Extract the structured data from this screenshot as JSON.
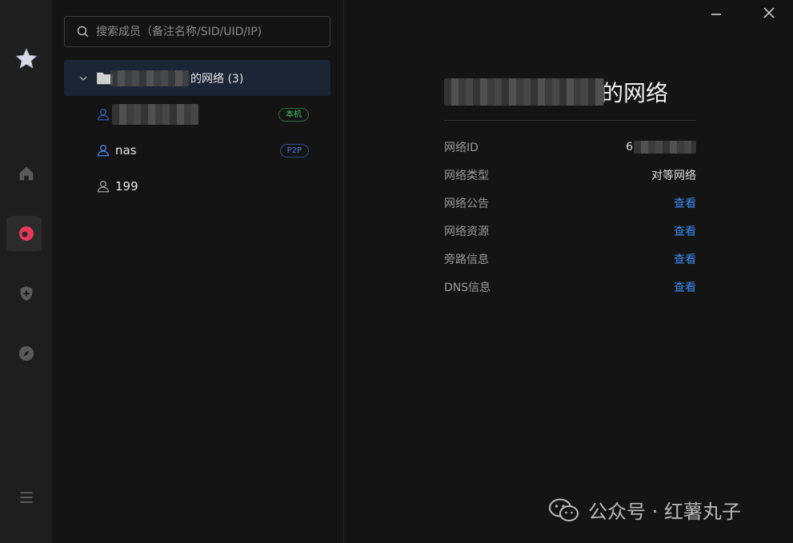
{
  "search": {
    "placeholder": "搜索成员（备注名称/SID/UID/IP)"
  },
  "group": {
    "label_suffix": "的网络 (3)"
  },
  "members": [
    {
      "name": "",
      "badge": "本机",
      "badge_kind": "local",
      "icon_color": "#2f5aa8"
    },
    {
      "name": "nas",
      "badge": "P2P",
      "badge_kind": "p2p",
      "icon_color": "#4b80e0"
    },
    {
      "name": "199",
      "badge": "",
      "badge_kind": "",
      "icon_color": "#9a9a9a"
    }
  ],
  "detail": {
    "title_suffix": "的网络",
    "rows": [
      {
        "label": "网络ID",
        "value": "6",
        "type": "masked"
      },
      {
        "label": "网络类型",
        "value": "对等网络",
        "type": "text"
      },
      {
        "label": "网络公告",
        "value": "查看",
        "type": "link"
      },
      {
        "label": "网络资源",
        "value": "查看",
        "type": "link"
      },
      {
        "label": "旁路信息",
        "value": "查看",
        "type": "link"
      },
      {
        "label": "DNS信息",
        "value": "查看",
        "type": "link"
      }
    ]
  },
  "watermark": {
    "text": "公众号 · 红薯丸子"
  },
  "colors": {
    "accent": "#3d8bf0",
    "local_badge": "#40c060",
    "p2p_badge": "#4b78d8",
    "active_icon": "#e8375a"
  }
}
